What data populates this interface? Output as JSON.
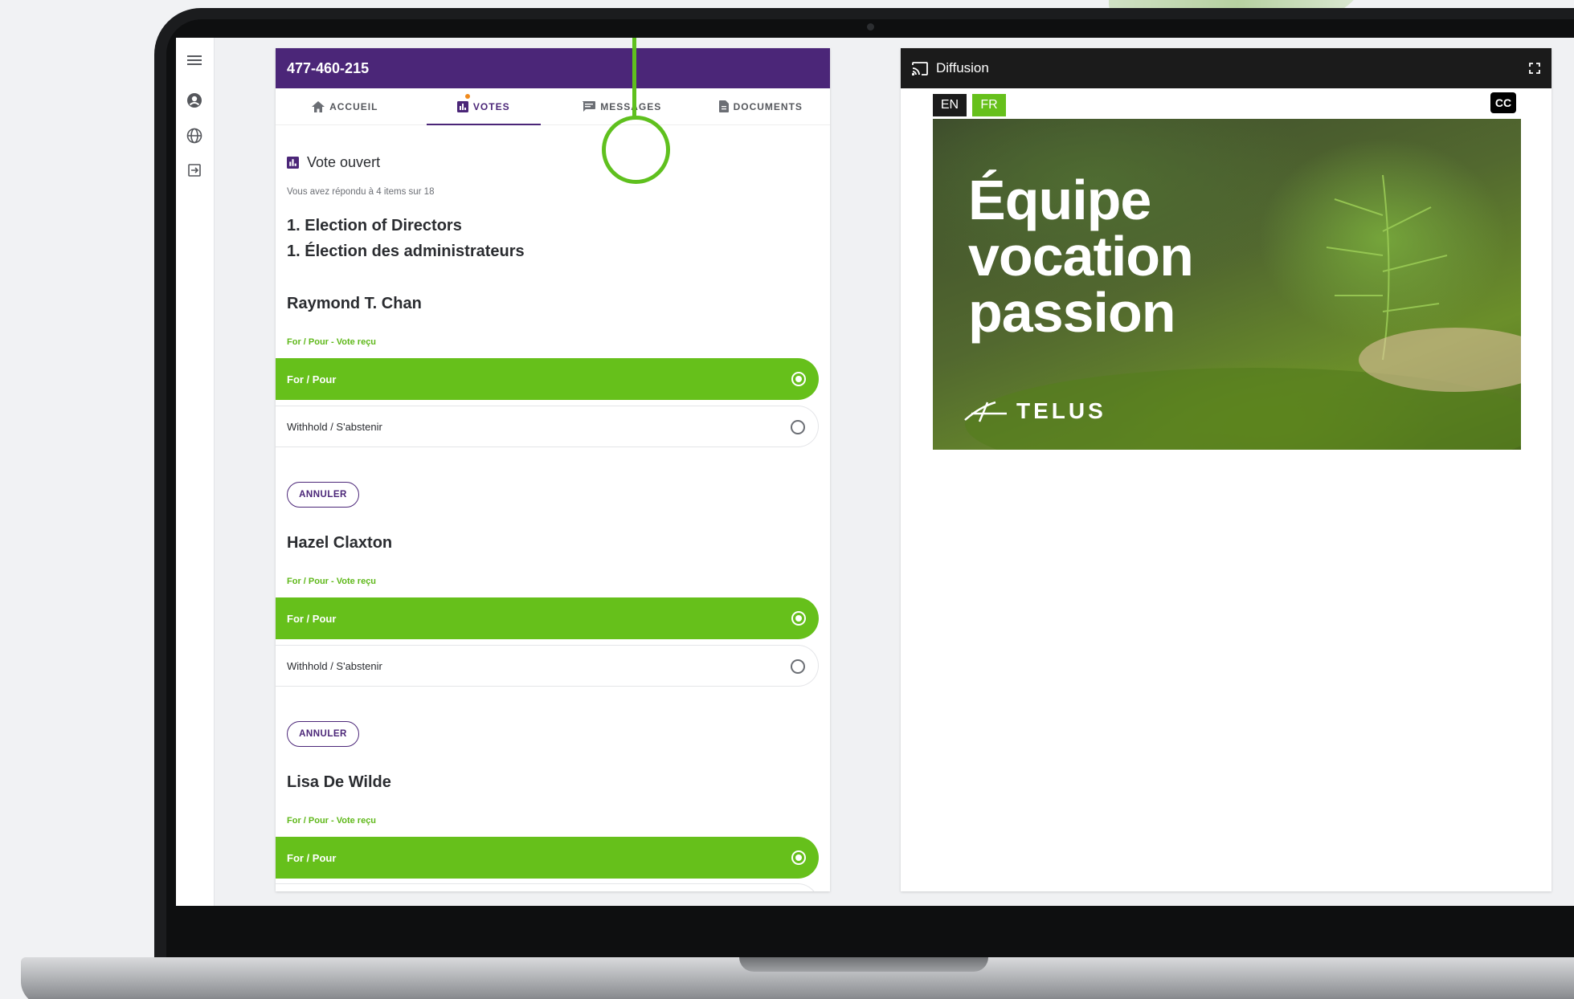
{
  "meeting": {
    "id": "477-460-215"
  },
  "tabs": [
    {
      "label": "ACCUEIL",
      "icon": "home-icon"
    },
    {
      "label": "VOTES",
      "icon": "bar-chart-icon"
    },
    {
      "label": "MESSAGES",
      "icon": "chat-icon"
    },
    {
      "label": "DOCUMENTS",
      "icon": "document-icon"
    }
  ],
  "vote": {
    "title": "Vote ouvert",
    "subtitle": "Vous avez répondu à 4 items sur 18",
    "item_en": "1. Election of Directors",
    "item_fr": "1. Élection des administrateurs",
    "candidates": [
      {
        "name": "Raymond T. Chan",
        "status": "For / Pour - Vote reçu",
        "selected": "For / Pour",
        "other": "Withhold / S'abstenir",
        "cancel": "ANNULER"
      },
      {
        "name": "Hazel Claxton",
        "status": "For / Pour - Vote reçu",
        "selected": "For / Pour",
        "other": "Withhold / S'abstenir",
        "cancel": "ANNULER"
      },
      {
        "name": "Lisa De Wilde",
        "status": "For / Pour - Vote reçu",
        "selected": "For / Pour"
      }
    ]
  },
  "diffusion": {
    "title": "Diffusion",
    "lang_en": "EN",
    "lang_fr": "FR",
    "cc": "CC",
    "video_lines": [
      "Équipe",
      "vocation",
      "passion"
    ],
    "brand": "TELUS"
  },
  "colors": {
    "purple": "#4b2678",
    "green": "#66c01b",
    "dark": "#1b1b1b"
  }
}
